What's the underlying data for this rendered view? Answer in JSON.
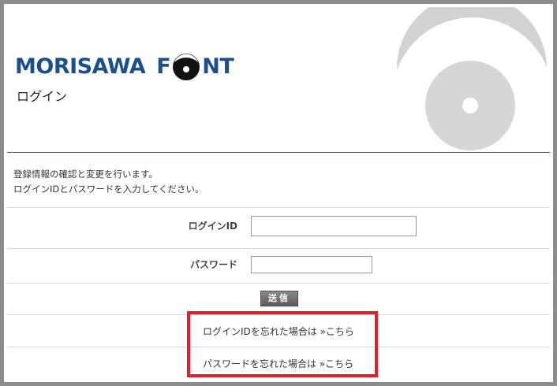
{
  "brand": {
    "word1": "MORISAWA",
    "letter_f": "F",
    "letters_nt": "NT"
  },
  "page": {
    "title": "ログイン"
  },
  "intro": {
    "line1": "登録情報の確認と変更を行います。",
    "line2": "ログインIDとパスワードを入力してください。"
  },
  "form": {
    "login_id_label": "ログインID",
    "login_id_value": "",
    "password_label": "パスワード",
    "password_value": "",
    "submit_label": "送信"
  },
  "links": {
    "forgot_id": "ログインIDを忘れた場合は »こちら",
    "forgot_password": "パスワードを忘れた場合は »こちら"
  },
  "colors": {
    "brand_blue": "#1c4f8e",
    "highlight_red": "#e2202b",
    "frame_gray": "#8c8c8c",
    "deco_gray": "#d2d2d2"
  },
  "icons": {
    "logo_o": "lens-o-icon",
    "decoration": "disc-crescent-decoration"
  }
}
